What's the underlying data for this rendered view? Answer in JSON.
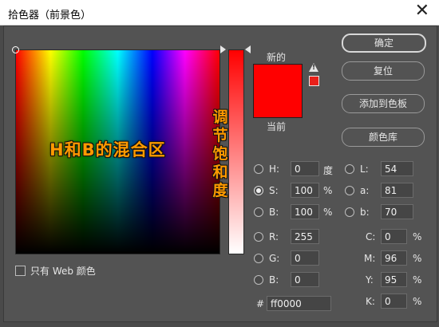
{
  "window": {
    "title": "拾色器（前景色）"
  },
  "overlay": {
    "field_label": "H和B的混合区",
    "slider_label": "调节饱和度"
  },
  "swatches": {
    "new_label": "新的",
    "current_label": "当前",
    "new_color": "#ff0000",
    "current_color": "#ff0000",
    "gamut_color": "#e8201a"
  },
  "buttons": {
    "ok": "确定",
    "reset": "复位",
    "add_swatch": "添加到色板",
    "libraries": "颜色库"
  },
  "hsb": {
    "h": {
      "label": "H:",
      "value": "0",
      "unit": "度"
    },
    "s": {
      "label": "S:",
      "value": "100",
      "unit": "%"
    },
    "b": {
      "label": "B:",
      "value": "100",
      "unit": "%"
    }
  },
  "lab": {
    "l": {
      "label": "L:",
      "value": "54"
    },
    "a": {
      "label": "a:",
      "value": "81"
    },
    "b": {
      "label": "b:",
      "value": "70"
    }
  },
  "rgb": {
    "r": {
      "label": "R:",
      "value": "255"
    },
    "g": {
      "label": "G:",
      "value": "0"
    },
    "b": {
      "label": "B:",
      "value": "0"
    }
  },
  "cmyk": {
    "c": {
      "label": "C:",
      "value": "0",
      "unit": "%"
    },
    "m": {
      "label": "M:",
      "value": "96",
      "unit": "%"
    },
    "y": {
      "label": "Y:",
      "value": "95",
      "unit": "%"
    },
    "k": {
      "label": "K:",
      "value": "0",
      "unit": "%"
    }
  },
  "hex": {
    "label": "#",
    "value": "ff0000"
  },
  "web_only": {
    "label": "只有 Web 颜色",
    "checked": false
  }
}
